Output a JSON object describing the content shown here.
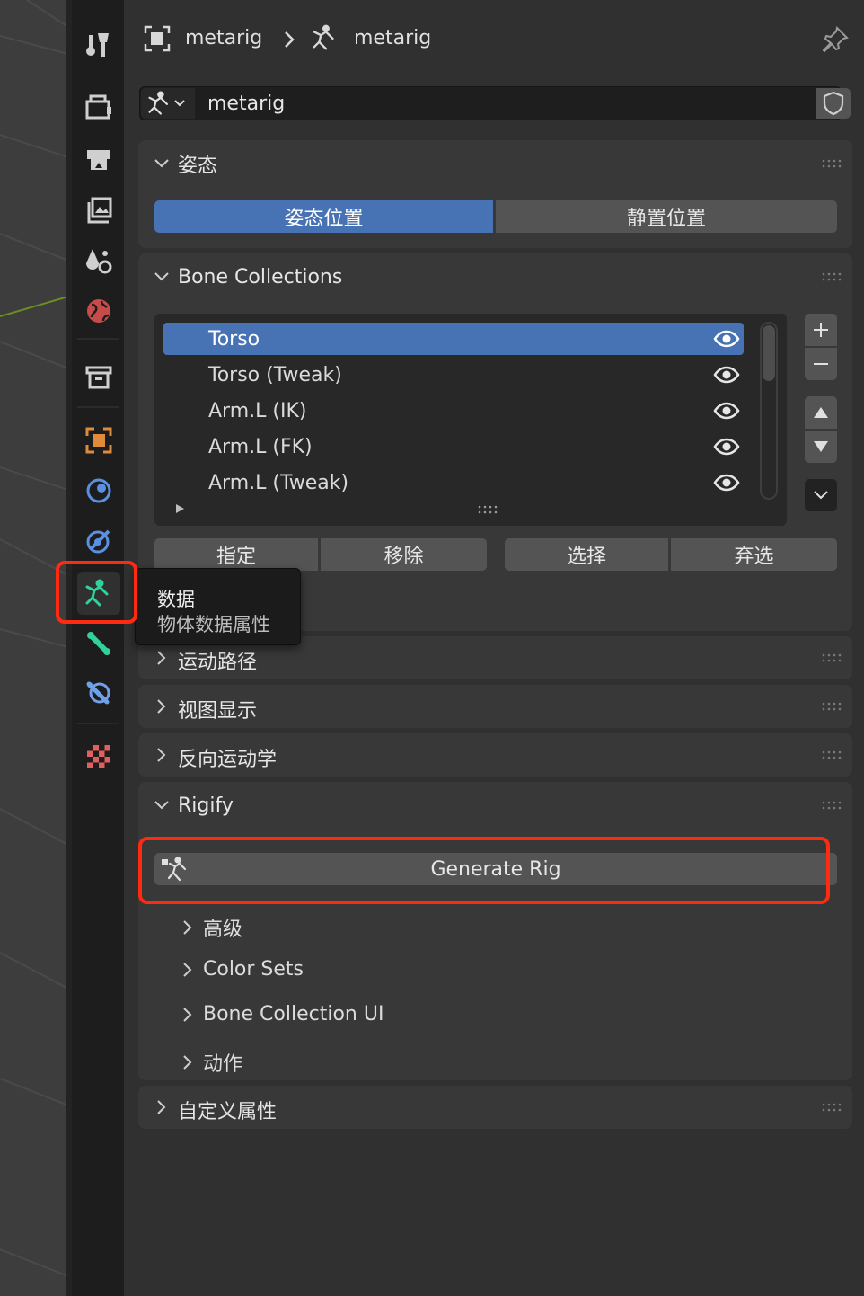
{
  "header": {
    "object_name": "metarig",
    "data_name": "metarig",
    "pin_icon": "pin-icon"
  },
  "datablock": {
    "name": "metarig",
    "shield_icon": "fake-user-shield-icon"
  },
  "tooltip": {
    "title": "数据",
    "subtitle": "物体数据属性"
  },
  "pose_panel": {
    "title": "姿态",
    "pose_position": "姿态位置",
    "rest_position": "静置位置"
  },
  "bone_collections": {
    "title": "Bone Collections",
    "items": [
      {
        "label": "Torso"
      },
      {
        "label": "Torso (Tweak)"
      },
      {
        "label": "Arm.L (IK)"
      },
      {
        "label": "Arm.L (FK)"
      },
      {
        "label": "Arm.L (Tweak)"
      }
    ],
    "assign": "指定",
    "remove": "移除",
    "select": "选择",
    "deselect": "弃选"
  },
  "collapsed_panels": {
    "motion_paths": "运动路径",
    "viewport_display": "视图显示",
    "inverse_kinematics": "反向运动学"
  },
  "rigify": {
    "title": "Rigify",
    "generate": "Generate Rig",
    "advanced": "高级",
    "color_sets": "Color Sets",
    "bone_collection_ui": "Bone Collection UI",
    "actions": "动作"
  },
  "custom_props": {
    "title": "自定义属性"
  },
  "colors": {
    "accent": "#4772b3",
    "highlight": "#ff2a12",
    "data_tab": "#2fd29a"
  }
}
